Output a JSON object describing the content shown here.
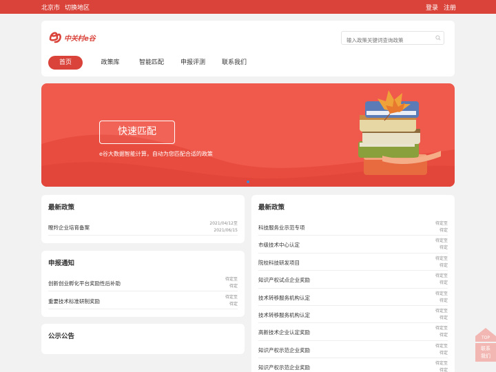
{
  "topbar": {
    "location": "北京市",
    "switch_region": "切换地区",
    "login": "登录",
    "register": "注册"
  },
  "header": {
    "logo_text": "中关村e谷",
    "search_placeholder": "输入政策关键词查询政策",
    "nav": [
      {
        "label": "首页",
        "active": true
      },
      {
        "label": "政策库",
        "active": false
      },
      {
        "label": "智能匹配",
        "active": false
      },
      {
        "label": "申报评测",
        "active": false
      },
      {
        "label": "联系我们",
        "active": false
      }
    ]
  },
  "banner": {
    "button_label": "快速匹配",
    "description": "e谷大数据智能计算，自动为您匹配合适的政策"
  },
  "latest_left": {
    "title": "最新政策",
    "items": [
      {
        "name": "瞪羚企业培育备案",
        "date1": "2021/04/12至",
        "date2": "2021/06/15"
      }
    ]
  },
  "notice": {
    "title": "申报通知",
    "items": [
      {
        "name": "创新创业孵化平台奖励性后补助",
        "date1": "待定至",
        "date2": "待定"
      },
      {
        "name": "重要技术标准研制奖励",
        "date1": "待定至",
        "date2": "待定"
      }
    ]
  },
  "announce": {
    "title": "公示公告"
  },
  "latest_right": {
    "title": "最新政策",
    "items": [
      {
        "name": "科技服务业示范专项",
        "date1": "待定至",
        "date2": "待定"
      },
      {
        "name": "市级技术中心认定",
        "date1": "待定至",
        "date2": "待定"
      },
      {
        "name": "院校科技研发项目",
        "date1": "待定至",
        "date2": "待定"
      },
      {
        "name": "知识产权试点企业奖励",
        "date1": "待定至",
        "date2": "待定"
      },
      {
        "name": "技术转移服务机构认定",
        "date1": "待定至",
        "date2": "待定"
      },
      {
        "name": "技术转移服务机构认定",
        "date1": "待定至",
        "date2": "待定"
      },
      {
        "name": "高新技术企业认定奖励",
        "date1": "待定至",
        "date2": "待定"
      },
      {
        "name": "知识产权示范企业奖励",
        "date1": "待定至",
        "date2": "待定"
      },
      {
        "name": "知识产权示范企业奖励",
        "date1": "待定至",
        "date2": "待定"
      }
    ]
  },
  "float": {
    "top_label": "TOP",
    "contact_line1": "联系",
    "contact_line2": "我们"
  },
  "colors": {
    "brand_red": "#d9433a",
    "banner_red": "#f05a4c"
  }
}
